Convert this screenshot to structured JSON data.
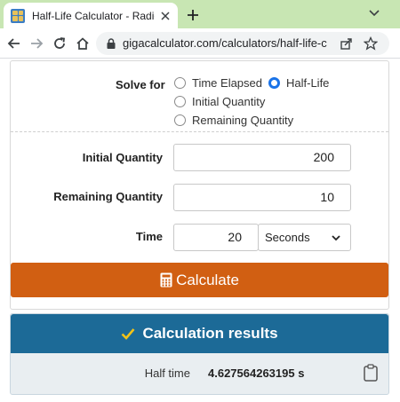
{
  "browser": {
    "tab_title": "Half-Life Calculator - Radioactive",
    "url": "gigacalculator.com/calculators/half-life-calcu..."
  },
  "form": {
    "solve_for_label": "Solve for",
    "options": [
      {
        "label": "Time Elapsed",
        "checked": false
      },
      {
        "label": "Half-Life",
        "checked": true
      },
      {
        "label": "Initial Quantity",
        "checked": false
      },
      {
        "label": "Remaining Quantity",
        "checked": false
      }
    ],
    "initial_quantity_label": "Initial Quantity",
    "initial_quantity_value": "200",
    "remaining_quantity_label": "Remaining Quantity",
    "remaining_quantity_value": "10",
    "time_label": "Time",
    "time_value": "20",
    "time_unit": "Seconds",
    "calculate_label": "Calculate"
  },
  "results": {
    "heading": "Calculation results",
    "half_time_label": "Half time",
    "half_time_value": "4.627564263195 s"
  },
  "colors": {
    "tabstrip": "#c8e6b3",
    "calculate_button": "#d15f12",
    "results_header": "#1c6a97",
    "check_icon": "#f2c318",
    "radio_selected": "#1a73e8"
  }
}
